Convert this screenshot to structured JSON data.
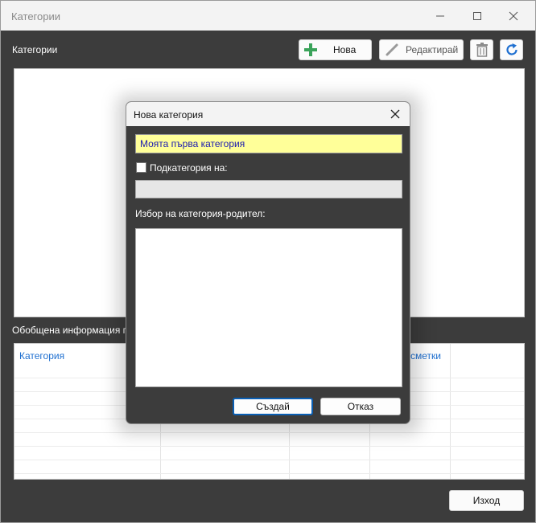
{
  "window": {
    "title": "Категории"
  },
  "main": {
    "section_label": "Категории",
    "summary_label": "Обобщена информация по к",
    "toolbar": {
      "new_label": "Нова",
      "edit_label": "Редактирай",
      "new_icon": "plus-icon",
      "edit_icon": "pencil-icon",
      "delete_icon": "trash-icon",
      "refresh_icon": "refresh-icon"
    },
    "grid": {
      "columns": [
        "Категория",
        "",
        "",
        "дсметки",
        ""
      ]
    },
    "exit_label": "Изход"
  },
  "dialog": {
    "title": "Нова категория",
    "name_value": "Моята първа категория",
    "subcategory_label": "Подкатегория на:",
    "subcategory_checked": false,
    "parent_value": "",
    "parent_select_label": "Избор на категория-родител:",
    "create_label": "Създай",
    "cancel_label": "Отказ"
  },
  "colors": {
    "accent": "#0a5fb4",
    "background": "#3c3c3c",
    "input_highlight": "#ffff99",
    "plus": "#3aa35a",
    "refresh": "#1e6fd0"
  }
}
